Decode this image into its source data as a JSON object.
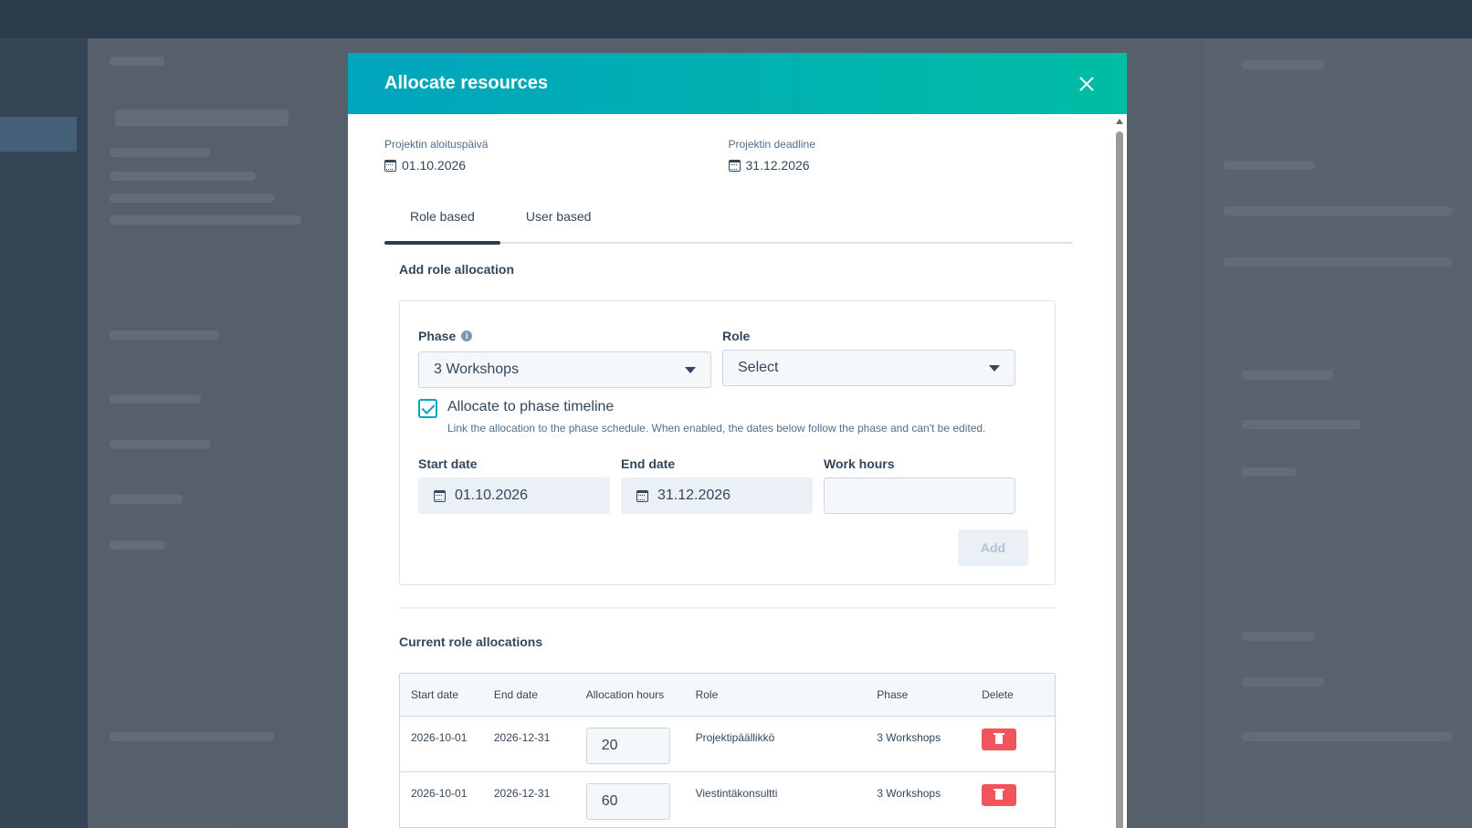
{
  "modal": {
    "title": "Allocate resources",
    "close_icon": "close-icon"
  },
  "project": {
    "start_label": "Projektin aloituspäivä",
    "start_value": "01.10.2026",
    "deadline_label": "Projektin deadline",
    "deadline_value": "31.12.2026"
  },
  "tabs": [
    {
      "label": "Role based",
      "active": true
    },
    {
      "label": "User based",
      "active": false
    }
  ],
  "add_section": {
    "title": "Add role allocation",
    "phase_label": "Phase",
    "phase_value": "3 Workshops",
    "role_label": "Role",
    "role_value": "Select",
    "checkbox_label": "Allocate to phase timeline",
    "checkbox_checked": true,
    "checkbox_help": "Link the allocation to the phase schedule. When enabled, the dates below follow the phase and can't be edited.",
    "start_label": "Start date",
    "start_value": "01.10.2026",
    "end_label": "End date",
    "end_value": "31.12.2026",
    "hours_label": "Work hours",
    "hours_value": "",
    "add_label": "Add"
  },
  "current": {
    "title": "Current role allocations",
    "headers": [
      "Start date",
      "End date",
      "Allocation hours",
      "Role",
      "Phase",
      "Delete"
    ],
    "rows": [
      {
        "start": "2026-10-01",
        "end": "2026-12-31",
        "hours": "20",
        "role": "Projektipäällikkö",
        "phase": "3 Workshops"
      },
      {
        "start": "2026-10-01",
        "end": "2026-12-31",
        "hours": "60",
        "role": "Viestintäkonsultti",
        "phase": "3 Workshops"
      }
    ]
  },
  "colors": {
    "header_gradient_start": "#00a4bd",
    "header_gradient_end": "#00bda5",
    "delete": "#f2545b"
  }
}
